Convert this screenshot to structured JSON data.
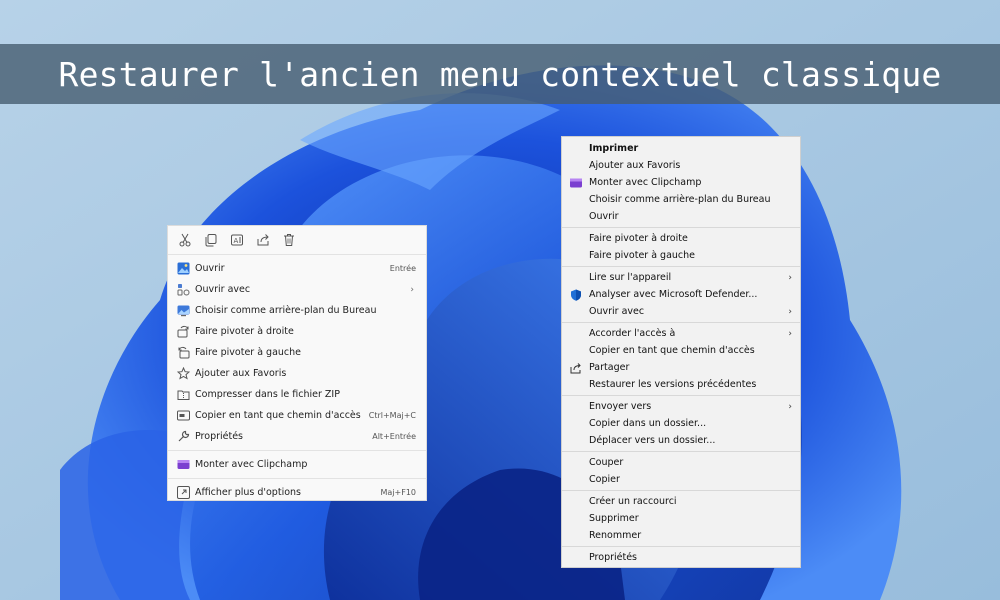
{
  "page": {
    "title": "Restaurer l'ancien menu contextuel classique"
  },
  "colors": {
    "background_light": "#a9c9e3",
    "bloom_dark": "#0a2e9c",
    "bloom_mid": "#1f5be0",
    "bloom_light": "#4d8cf5",
    "banner": "#465c70",
    "menu_bg": "#f9f9f9",
    "classic_bg": "#f2f2f2"
  },
  "new_menu": {
    "quick_actions": [
      {
        "name": "cut-icon"
      },
      {
        "name": "copy-icon"
      },
      {
        "name": "rename-icon"
      },
      {
        "name": "share-icon"
      },
      {
        "name": "delete-icon"
      }
    ],
    "items": [
      {
        "label": "Ouvrir",
        "shortcut": "Entrée",
        "icon": "image-icon"
      },
      {
        "label": "Ouvrir avec",
        "shortcut": "",
        "icon": "open-with-icon",
        "submenu": true
      },
      {
        "label": "Choisir comme arrière-plan du Bureau",
        "shortcut": "",
        "icon": "wallpaper-icon"
      },
      {
        "label": "Faire pivoter à droite",
        "shortcut": "",
        "icon": "rotate-right-icon"
      },
      {
        "label": "Faire pivoter à gauche",
        "shortcut": "",
        "icon": "rotate-left-icon"
      },
      {
        "label": "Ajouter aux Favoris",
        "shortcut": "",
        "icon": "star-icon"
      },
      {
        "label": "Compresser dans le fichier ZIP",
        "shortcut": "",
        "icon": "zip-icon"
      },
      {
        "label": "Copier en tant que chemin d'accès",
        "shortcut": "Ctrl+Maj+C",
        "icon": "path-icon"
      },
      {
        "label": "Propriétés",
        "shortcut": "Alt+Entrée",
        "icon": "wrench-icon"
      },
      {
        "label": "Monter avec Clipchamp",
        "shortcut": "",
        "icon": "clipchamp-icon"
      },
      {
        "label": "Afficher plus d'options",
        "shortcut": "Maj+F10",
        "icon": "more-options-icon"
      }
    ]
  },
  "classic_menu": {
    "groups": [
      [
        {
          "label": "Imprimer",
          "bold": true
        },
        {
          "label": "Ajouter aux Favoris"
        },
        {
          "label": "Monter avec Clipchamp",
          "icon": "clipchamp-icon"
        },
        {
          "label": "Choisir comme arrière-plan du Bureau"
        },
        {
          "label": "Ouvrir"
        }
      ],
      [
        {
          "label": "Faire pivoter à droite"
        },
        {
          "label": "Faire pivoter à gauche"
        }
      ],
      [
        {
          "label": "Lire sur l'appareil",
          "submenu": true
        },
        {
          "label": "Analyser avec Microsoft Defender...",
          "icon": "defender-shield-icon"
        },
        {
          "label": "Ouvrir avec",
          "submenu": true
        }
      ],
      [
        {
          "label": "Accorder l'accès à",
          "submenu": true
        },
        {
          "label": "Copier en tant que chemin d'accès"
        },
        {
          "label": "Partager",
          "icon": "share-icon"
        },
        {
          "label": "Restaurer les versions précédentes"
        }
      ],
      [
        {
          "label": "Envoyer vers",
          "submenu": true
        },
        {
          "label": "Copier dans un dossier..."
        },
        {
          "label": "Déplacer vers un dossier..."
        }
      ],
      [
        {
          "label": "Couper"
        },
        {
          "label": "Copier"
        }
      ],
      [
        {
          "label": "Créer un raccourci"
        },
        {
          "label": "Supprimer"
        },
        {
          "label": "Renommer"
        }
      ],
      [
        {
          "label": "Propriétés"
        }
      ]
    ]
  }
}
